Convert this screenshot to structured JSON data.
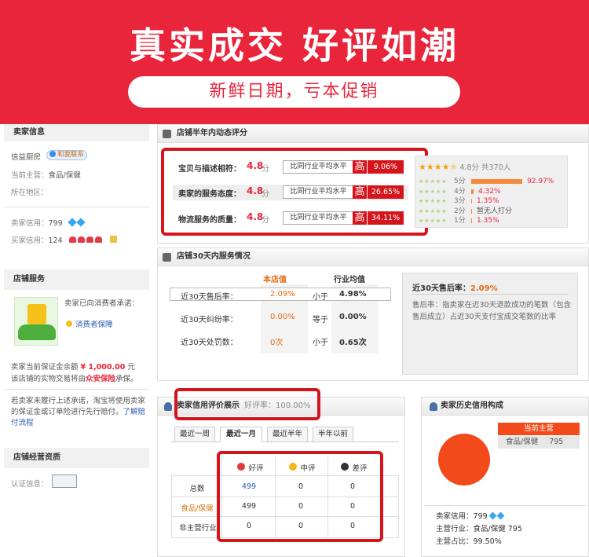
{
  "banner": {
    "title": "真实成交 好评如潮",
    "subtitle": "新鲜日期，亏本促销"
  },
  "seller_info": {
    "heading": "卖家信息",
    "shop_name": "信益厨房",
    "contact_badge": "和我联系",
    "main_business_label": "当前主营：",
    "main_business_value": "食品/保健",
    "region_label": "所在地区：",
    "seller_credit_label": "卖家信用：",
    "seller_credit_value": "799",
    "buyer_credit_label": "买家信用：",
    "buyer_credit_value": "124"
  },
  "shop_service": {
    "heading": "店铺服务",
    "promise_text": "卖家已向消费者承诺：",
    "guarantee_label": "消费者保障",
    "deposit_text_1": "卖家当前保证金余额",
    "deposit_amount": "¥ 1,000.00",
    "deposit_text_2": "元",
    "insurance_text_1": "该店铺的实物交易将由",
    "insurance_name": "众安保险",
    "insurance_text_2": "承保。",
    "notice_text": "若卖家未履行上述承诺，淘宝将使用卖家的保证金或订单险进行先行赔付。",
    "learn_more": "了解赔付流程"
  },
  "qualification": {
    "heading": "店铺经营资质",
    "cert_label": "认证信息："
  },
  "dsr": {
    "title": "店铺半年内动态评分",
    "rows": [
      {
        "label": "宝贝与描述相符：",
        "score": "4.8",
        "unit": "分",
        "compare": "比同行业平均水平",
        "level": "高",
        "pct": "9.06%"
      },
      {
        "label": "卖家的服务态度：",
        "score": "4.8",
        "unit": "分",
        "compare": "比同行业平均水平",
        "level": "高",
        "pct": "26.65%"
      },
      {
        "label": "物流服务的质量：",
        "score": "4.8",
        "unit": "分",
        "compare": "比同行业平均水平",
        "level": "高",
        "pct": "34.11%"
      }
    ],
    "summary_score": "4.8分",
    "summary_count": "共370人",
    "distribution": [
      {
        "stars": "5分",
        "pct": 92.97,
        "label": "92.97%"
      },
      {
        "stars": "4分",
        "pct": 4.32,
        "label": "4.32%"
      },
      {
        "stars": "3分",
        "pct": 1.35,
        "label": "1.35%"
      },
      {
        "stars": "2分",
        "pct": 0,
        "label": "暂无人打分"
      },
      {
        "stars": "1分",
        "pct": 1.35,
        "label": "1.35%"
      }
    ]
  },
  "service30": {
    "title": "店铺30天内服务情况",
    "col_shop": "本店值",
    "col_avg": "行业均值",
    "rows": [
      {
        "label": "近30天售后率：",
        "shop": "2.09%",
        "cmp": "小于",
        "avg": "4.98%"
      },
      {
        "label": "近30天纠纷率：",
        "shop": "0.00%",
        "cmp": "等于",
        "avg": "0.00%"
      },
      {
        "label": "近30天处罚数：",
        "shop": "0次",
        "cmp": "小于",
        "avg": "0.65次"
      }
    ],
    "detail_title": "近30天售后率：",
    "detail_value": "2.09%",
    "detail_desc": "售后率：指卖家在近30天退款成功的笔数（包含售后成立）占近30天支付宝成交笔数的比率"
  },
  "credit": {
    "title": "卖家信用评价展示",
    "rate_label": "好评率：",
    "rate_value": "100.00%",
    "tabs": [
      "最近一周",
      "最近一月",
      "最近半年",
      "半年以前"
    ],
    "headers": [
      "好评",
      "中评",
      "差评"
    ],
    "rows": [
      {
        "label": "总数",
        "values": [
          "499",
          "0",
          "0"
        ]
      },
      {
        "label": "食品/保健",
        "values": [
          "499",
          "0",
          "0"
        ]
      },
      {
        "label": "非主营行业",
        "values": [
          "0",
          "0",
          "0"
        ]
      }
    ]
  },
  "history": {
    "title": "卖家历史信用构成",
    "tag_current": "当前主营",
    "tag_category": "食品/保健",
    "tag_value": "795",
    "seller_credit_label": "卖家信用：",
    "seller_credit_value": "799",
    "main_industry_label": "主营行业：",
    "main_industry_value": "食品/保健 795",
    "main_share_label": "主营占比：",
    "main_share_value": "99.50%",
    "pie_color": "#f24a1a"
  }
}
